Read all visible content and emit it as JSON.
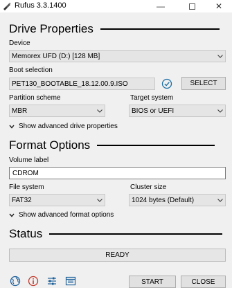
{
  "window": {
    "title": "Rufus 3.3.1400",
    "minimize_glyph": "—",
    "close_glyph": "✕"
  },
  "drive_properties": {
    "heading": "Drive Properties",
    "device_label": "Device",
    "device_value": "Memorex UFD (D:) [128 MB]",
    "boot_selection_label": "Boot selection",
    "boot_selection_value": "PET130_BOOTABLE_18.12.00.9.ISO",
    "select_button": "SELECT",
    "partition_scheme_label": "Partition scheme",
    "partition_scheme_value": "MBR",
    "target_system_label": "Target system",
    "target_system_value": "BIOS or UEFI",
    "advanced_toggle": "Show advanced drive properties"
  },
  "format_options": {
    "heading": "Format Options",
    "volume_label_label": "Volume label",
    "volume_label_value": "CDROM",
    "file_system_label": "File system",
    "file_system_value": "FAT32",
    "cluster_size_label": "Cluster size",
    "cluster_size_value": "1024 bytes (Default)",
    "advanced_toggle": "Show advanced format options"
  },
  "status": {
    "heading": "Status",
    "text": "READY"
  },
  "footer": {
    "start_button": "START",
    "close_button": "CLOSE",
    "icons": [
      "globe-icon",
      "info-icon",
      "settings-sliders-icon",
      "log-icon"
    ]
  },
  "colors": {
    "accent": "#0078d7",
    "check_icon": "#1c6ea4"
  }
}
